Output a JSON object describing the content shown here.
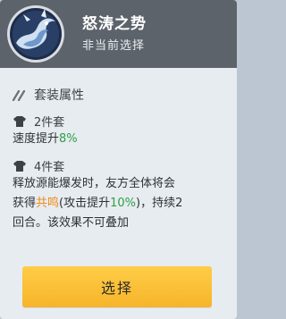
{
  "header": {
    "set_name": "怒涛之势",
    "status": "非当前选择"
  },
  "section": {
    "title": "套装属性"
  },
  "bonuses": [
    {
      "label": "2件套",
      "desc_prefix": "速度提升",
      "highlight": "8%",
      "desc_suffix": ""
    },
    {
      "label": "4件套",
      "line1": "释放源能爆发时，友方全体将会",
      "line2_prefix": "获得",
      "line2_keyword": "共鸣",
      "line2_mid": "(攻击提升",
      "line2_pct": "10%",
      "line2_suffix": ")，持续2",
      "line3": "回合。该效果不可叠加"
    }
  ],
  "button": {
    "label": "选择"
  },
  "colors": {
    "header_bg": "#5d636a",
    "panel_bg": "#e7ecf1",
    "highlight_green": "#2ea043",
    "highlight_orange": "#f08a11",
    "button_bg": "#f6b42a"
  },
  "icons": {
    "emblem": "wave-emblem-icon",
    "section": "slash-icon",
    "piece": "shirt-icon"
  }
}
